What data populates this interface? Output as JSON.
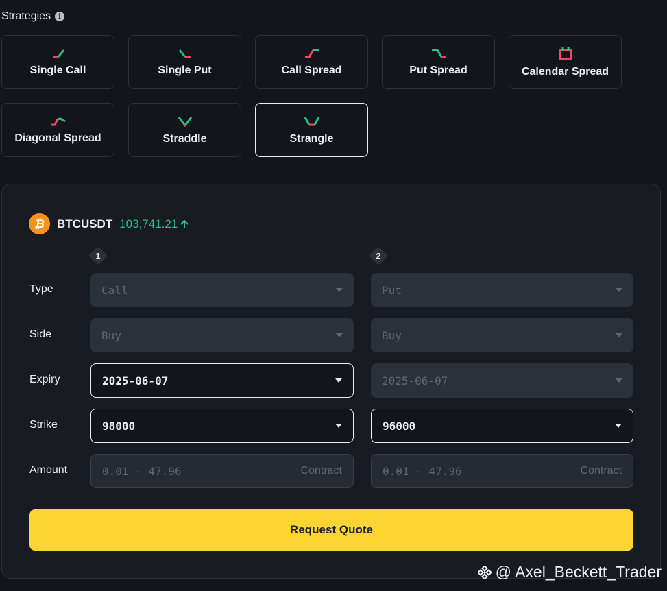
{
  "header": {
    "title": "Strategies",
    "info_icon": "info-icon"
  },
  "strategies": [
    {
      "label": "Single Call",
      "icon": "single-call-icon"
    },
    {
      "label": "Single Put",
      "icon": "single-put-icon"
    },
    {
      "label": "Call Spread",
      "icon": "call-spread-icon"
    },
    {
      "label": "Put Spread",
      "icon": "put-spread-icon"
    },
    {
      "label": "Calendar Spread",
      "icon": "calendar-spread-icon"
    },
    {
      "label": "Diagonal Spread",
      "icon": "diagonal-spread-icon"
    },
    {
      "label": "Straddle",
      "icon": "straddle-icon"
    },
    {
      "label": "Strangle",
      "icon": "strangle-icon",
      "selected": true
    }
  ],
  "ticker": {
    "symbol": "BTCUSDT",
    "price": "103,741.21",
    "direction_icon": "arrow-up-icon",
    "coin_icon": "bitcoin-icon"
  },
  "legs": [
    "1",
    "2"
  ],
  "rows": {
    "type": "Type",
    "side": "Side",
    "expiry": "Expiry",
    "strike": "Strike",
    "amount": "Amount"
  },
  "leg1": {
    "type": "Call",
    "side": "Buy",
    "expiry": "2025-06-07",
    "strike": "98000",
    "amount_placeholder": "0.01 - 47.96",
    "amount_unit": "Contract"
  },
  "leg2": {
    "type": "Put",
    "side": "Buy",
    "expiry": "2025-06-07",
    "strike": "96000",
    "amount_placeholder": "0.01 - 47.96",
    "amount_unit": "Contract"
  },
  "action": {
    "request_quote": "Request Quote"
  },
  "watermark": {
    "text": "@ Axel_Beckett_Trader"
  },
  "colors": {
    "accent": "#fcd535",
    "up": "#2ebd85",
    "down": "#f6465d",
    "bitcoin": "#f7931a"
  }
}
